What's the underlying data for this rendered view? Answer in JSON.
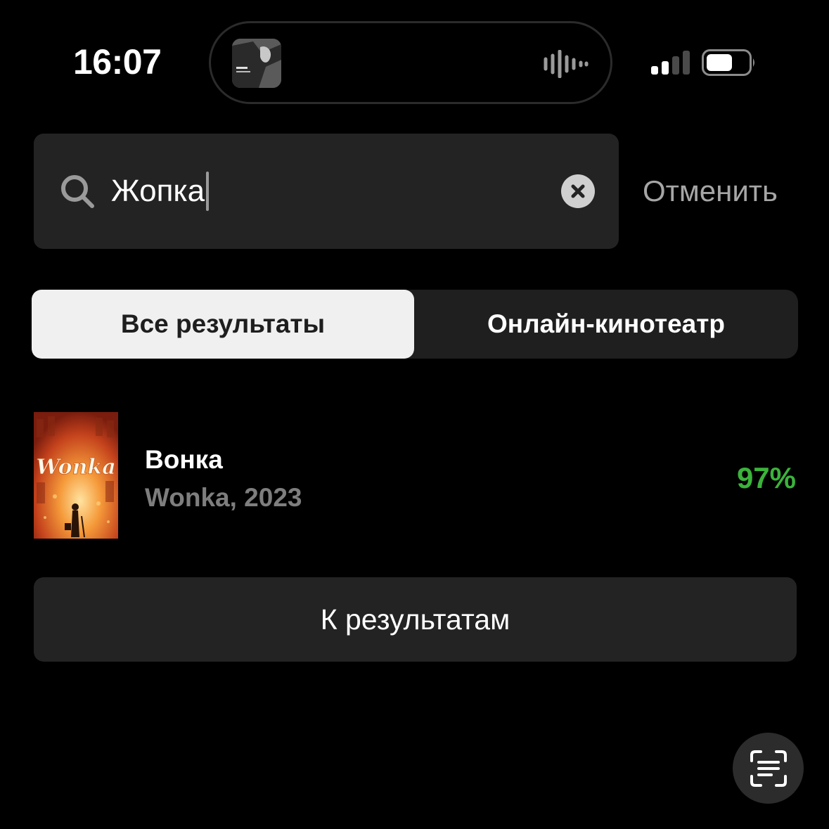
{
  "status_bar": {
    "time": "16:07"
  },
  "search": {
    "query": "Жопка",
    "cancel_label": "Отменить"
  },
  "tabs": [
    {
      "label": "Все результаты",
      "selected": true
    },
    {
      "label": "Онлайн-кинотеатр",
      "selected": false
    }
  ],
  "result": {
    "title": "Вонка",
    "subtitle": "Wonka, 2023",
    "rating": "97%",
    "poster_logo_text": "Wonka"
  },
  "results_button_label": "К результатам",
  "colors": {
    "background": "#000000",
    "surface": "#232323",
    "rating_green": "#3bb33b",
    "muted_text": "#7e7e7e",
    "selected_tab": "#f0f0f0"
  },
  "icons": {
    "island_media": "album-art-icon",
    "island_audio": "waveform-icon",
    "signal": "cellular-signal-icon",
    "battery": "battery-icon",
    "search": "search-icon",
    "clear": "clear-x-icon",
    "scan": "text-scan-icon"
  }
}
